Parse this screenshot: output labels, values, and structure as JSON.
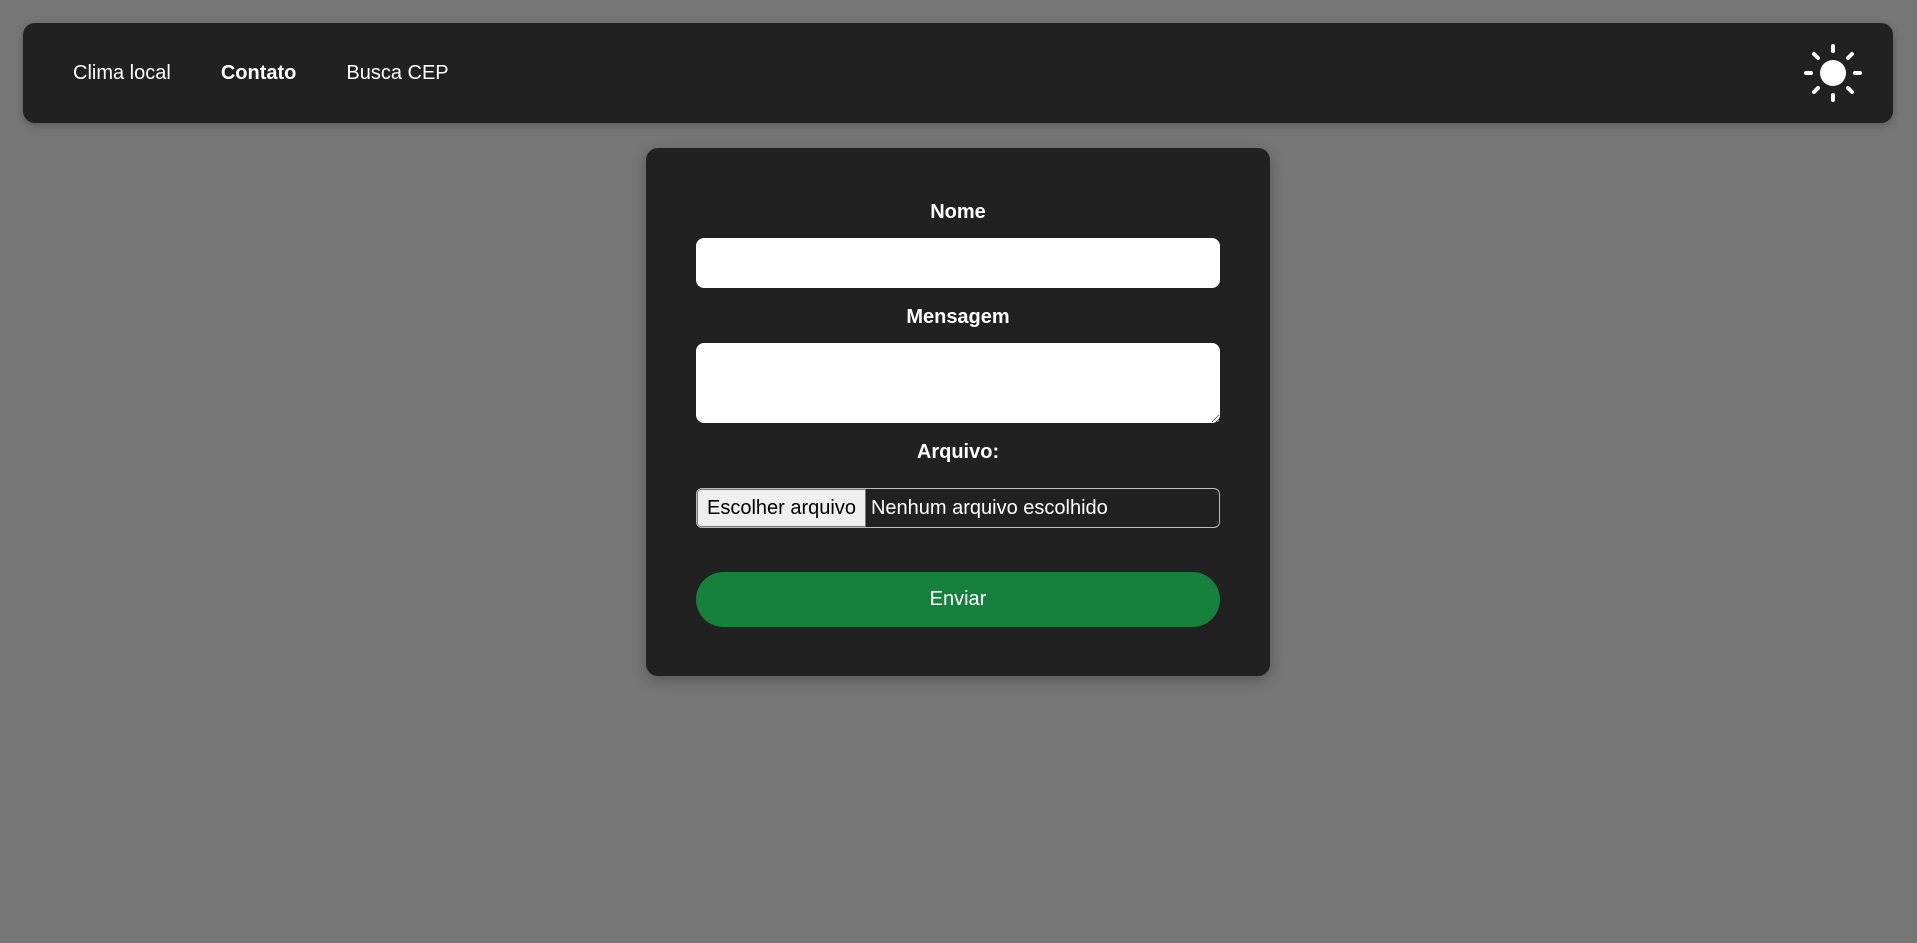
{
  "nav": {
    "links": [
      {
        "label": "Clima local",
        "active": false
      },
      {
        "label": "Contato",
        "active": true
      },
      {
        "label": "Busca CEP",
        "active": false
      }
    ],
    "theme_icon": "sun-icon"
  },
  "form": {
    "name_label": "Nome",
    "name_value": "",
    "message_label": "Mensagem",
    "message_value": "",
    "file_label": "Arquivo:",
    "file_button_label": "Escolher arquivo",
    "file_status": "Nenhum arquivo escolhido",
    "submit_label": "Enviar"
  },
  "colors": {
    "page_background": "#767676",
    "panel_background": "#212121",
    "submit_button": "#16803d",
    "text": "#ffffff"
  }
}
